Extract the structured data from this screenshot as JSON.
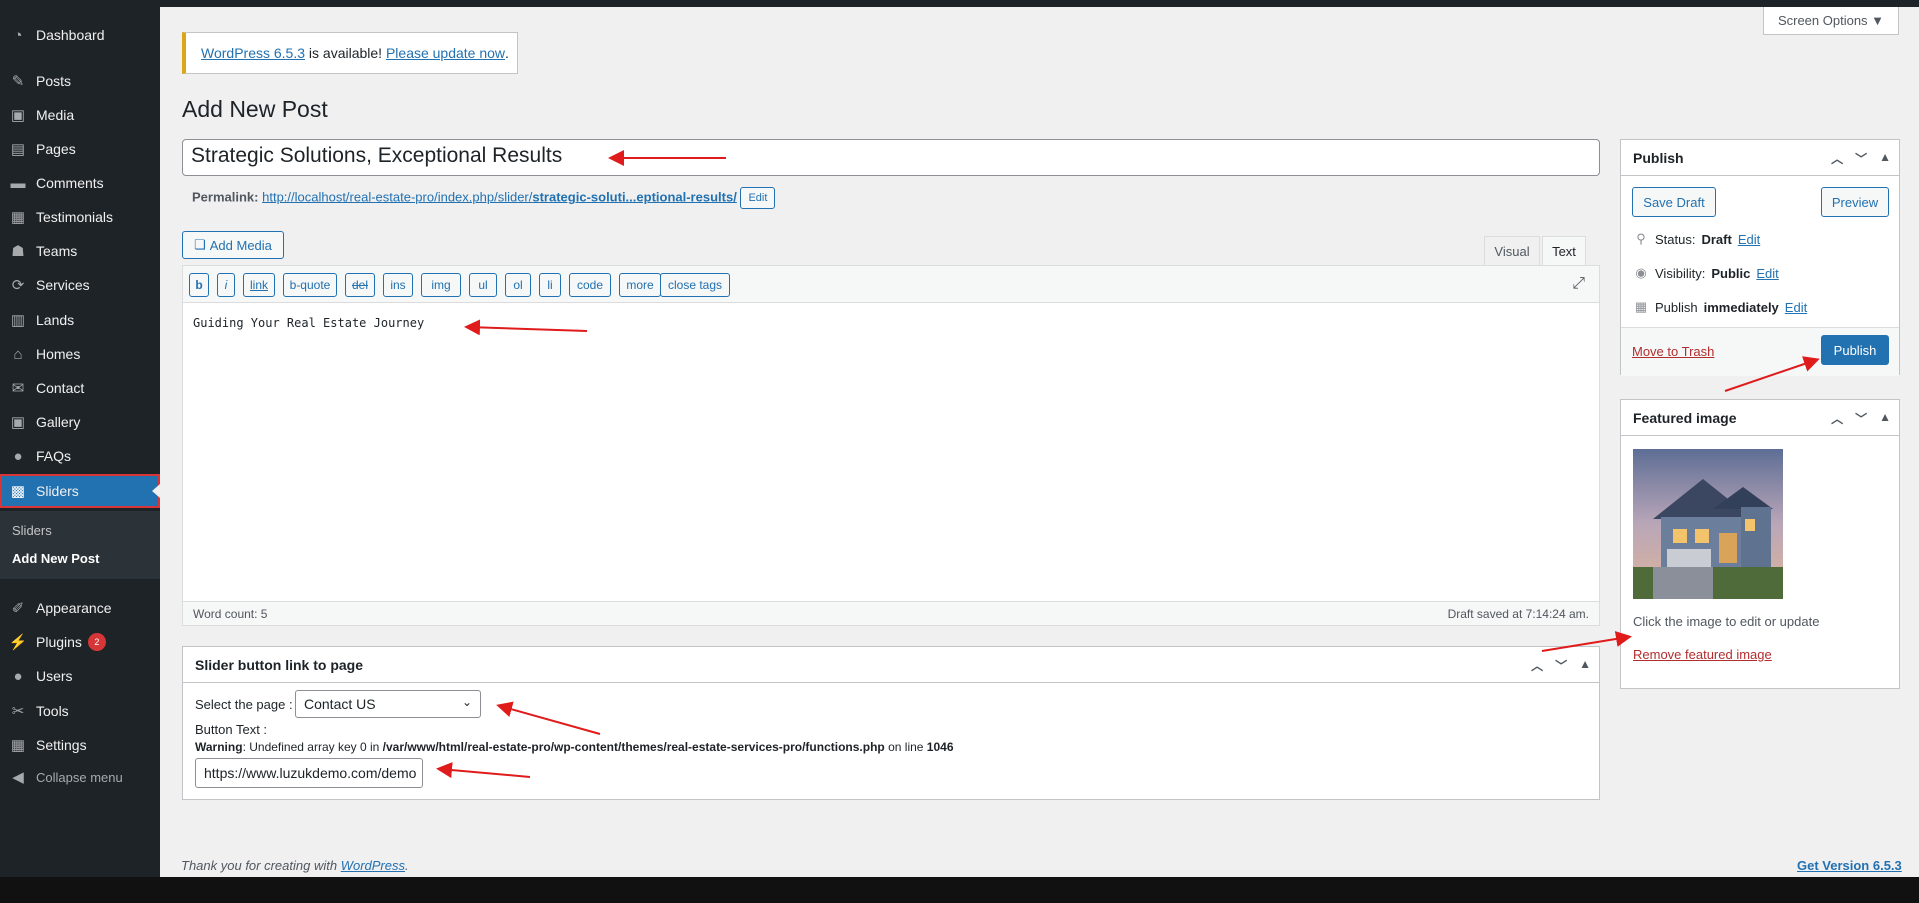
{
  "sidebar": {
    "items": [
      {
        "id": "dashboard",
        "label": "Dashboard",
        "icon": "dashboard-icon"
      },
      {
        "id": "posts",
        "label": "Posts",
        "icon": "pin-icon"
      },
      {
        "id": "media",
        "label": "Media",
        "icon": "media-icon"
      },
      {
        "id": "pages",
        "label": "Pages",
        "icon": "pages-icon"
      },
      {
        "id": "comments",
        "label": "Comments",
        "icon": "comments-icon"
      },
      {
        "id": "testimonials",
        "label": "Testimonials",
        "icon": "testimonials-icon"
      },
      {
        "id": "teams",
        "label": "Teams",
        "icon": "teams-icon"
      },
      {
        "id": "services",
        "label": "Services",
        "icon": "services-icon"
      },
      {
        "id": "lands",
        "label": "Lands",
        "icon": "lands-icon"
      },
      {
        "id": "homes",
        "label": "Homes",
        "icon": "home-icon"
      },
      {
        "id": "contact",
        "label": "Contact",
        "icon": "envelope-icon"
      },
      {
        "id": "gallery",
        "label": "Gallery",
        "icon": "gallery-icon"
      },
      {
        "id": "faqs",
        "label": "FAQs",
        "icon": "faq-icon"
      },
      {
        "id": "sliders",
        "label": "Sliders",
        "icon": "sliders-icon"
      },
      {
        "id": "appearance",
        "label": "Appearance",
        "icon": "brush-icon"
      },
      {
        "id": "plugins",
        "label": "Plugins",
        "icon": "plugin-icon",
        "badge": "2"
      },
      {
        "id": "users",
        "label": "Users",
        "icon": "users-icon"
      },
      {
        "id": "tools",
        "label": "Tools",
        "icon": "wrench-icon"
      },
      {
        "id": "settings",
        "label": "Settings",
        "icon": "settings-icon"
      },
      {
        "id": "collapse",
        "label": "Collapse menu",
        "icon": "collapse-icon"
      }
    ],
    "submenu": [
      "Sliders",
      "Add New Post"
    ]
  },
  "screen_options": "Screen Options ▼",
  "notice": {
    "version_link": "WordPress 6.5.3",
    "middle": " is available! ",
    "update_link": "Please update now",
    "end": "."
  },
  "page_title": "Add New Post",
  "post": {
    "title": "Strategic Solutions, Exceptional Results",
    "permalink_label": "Permalink:",
    "permalink_base": "http://localhost/real-estate-pro/index.php/slider/",
    "permalink_slug": "strategic-soluti...eptional-results/",
    "edit_label": "Edit"
  },
  "editor": {
    "add_media": "Add Media",
    "tabs": {
      "visual": "Visual",
      "text": "Text"
    },
    "quicktags": [
      "b",
      "i",
      "link",
      "b-quote",
      "del",
      "ins",
      "img",
      "ul",
      "ol",
      "li",
      "code",
      "more",
      "close tags"
    ],
    "content": "Guiding Your Real Estate Journey",
    "word_count": "Word count: 5",
    "draft_saved": "Draft saved at 7:14:24 am."
  },
  "slider_box": {
    "title": "Slider button link to page",
    "select_label": "Select the page :",
    "selected_page": "Contact US",
    "button_text_label": "Button Text :",
    "warning_label": "Warning",
    "warning_text": ": Undefined array key 0 in ",
    "warning_path": "/var/www/html/real-estate-pro/wp-content/themes/real-estate-services-pro/functions.php",
    "warning_line_text": " on line ",
    "warning_line": "1046",
    "button_url": "https://www.luzukdemo.com/demo"
  },
  "publish_box": {
    "title": "Publish",
    "save_draft": "Save Draft",
    "preview": "Preview",
    "status_label": "Status: ",
    "status_value": "Draft",
    "visibility_label": "Visibility: ",
    "visibility_value": "Public",
    "publish_label": "Publish ",
    "publish_value": "immediately",
    "edit": "Edit",
    "trash": "Move to Trash",
    "publish_button": "Publish"
  },
  "featured_box": {
    "title": "Featured image",
    "hint": "Click the image to edit or update",
    "remove": "Remove featured image"
  },
  "footer": {
    "thanks_prefix": "Thank you for creating with ",
    "thanks_link": "WordPress",
    "thanks_suffix": ".",
    "version": "Get Version 6.5.3"
  },
  "colors": {
    "admin_bar": "#1d2327",
    "accent": "#2271b1",
    "danger": "#d63638",
    "arrows": "#e01b1b"
  }
}
